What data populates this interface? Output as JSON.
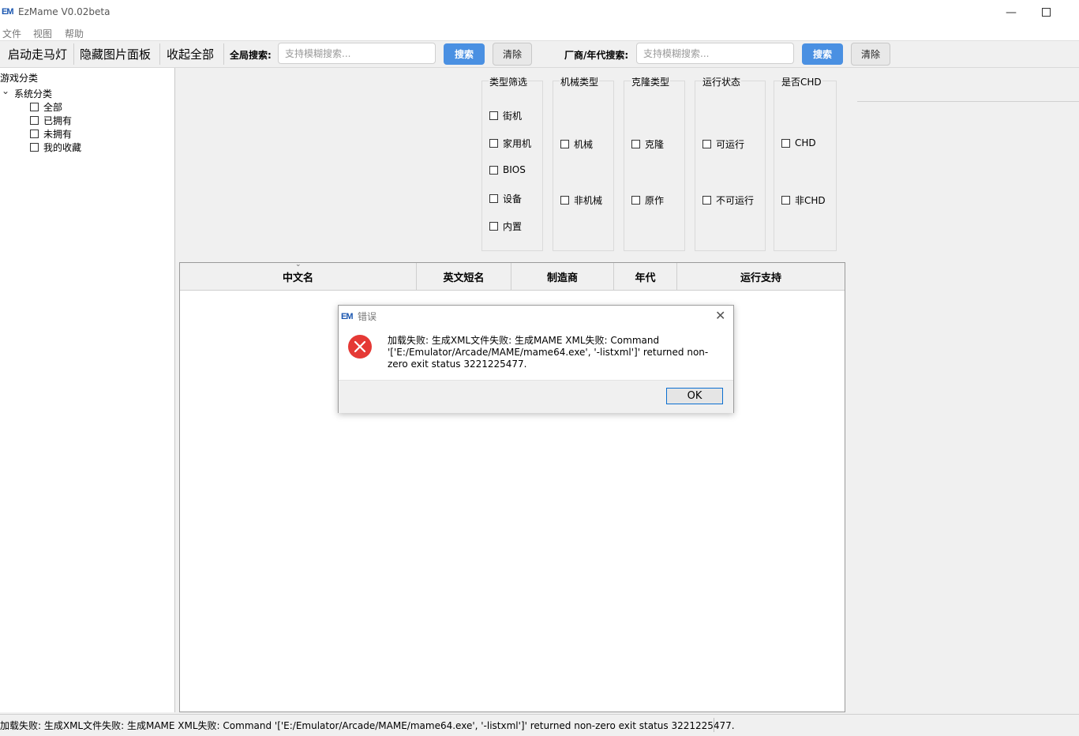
{
  "window": {
    "logo": "EM",
    "title": "EzMame V0.02beta"
  },
  "menu": [
    "文件",
    "视图",
    "帮助"
  ],
  "toolbar": {
    "marquee_button": "启动走马灯",
    "hide_image_panel_button": "隐藏图片面板",
    "collapse_all_button": "收起全部",
    "global_search_label": "全局搜索:",
    "global_search_placeholder": "支持模糊搜索...",
    "global_search_value": "",
    "global_search_button": "搜索",
    "global_clear_button": "清除",
    "maker_year_search_label": "厂商/年代搜索:",
    "maker_year_search_placeholder": "支持模糊搜索...",
    "maker_year_search_value": "",
    "maker_year_search_button": "搜索",
    "maker_year_clear_button": "清除"
  },
  "sidebar": {
    "title": "游戏分类",
    "system_category": "系统分类",
    "items": [
      "全部",
      "已拥有",
      "未拥有",
      "我的收藏"
    ]
  },
  "filters": [
    {
      "title": "类型筛选",
      "options": [
        "街机",
        "家用机",
        "BIOS",
        "设备",
        "内置"
      ]
    },
    {
      "title": "机械类型",
      "options": [
        "机械",
        "非机械"
      ]
    },
    {
      "title": "克隆类型",
      "options": [
        "克隆",
        "原作"
      ]
    },
    {
      "title": "运行状态",
      "options": [
        "可运行",
        "不可运行"
      ]
    },
    {
      "title": "是否CHD",
      "options": [
        "CHD",
        "非CHD"
      ]
    }
  ],
  "table": {
    "columns": [
      "中文名",
      "英文短名",
      "制造商",
      "年代",
      "运行支持"
    ],
    "rows": []
  },
  "dialog": {
    "logo": "EM",
    "title": "错误",
    "message": "加载失败: 生成XML文件失败: 生成MAME XML失败: Command '['E:/Emulator/Arcade/MAME/mame64.exe', '-listxml']' returned non-zero exit status 3221225477.",
    "ok_button": "OK",
    "icon": "error-icon"
  },
  "status": {
    "text": "加载失败: 生成XML文件失败: 生成MAME XML失败: Command '['E:/Emulator/Arcade/MAME/mame64.exe', '-listxml']' returned non-zero exit status 3221225477."
  },
  "colors": {
    "accent_button": "#4a90e2",
    "error_red": "#e53935",
    "logo_blue": "#1a56b0"
  }
}
